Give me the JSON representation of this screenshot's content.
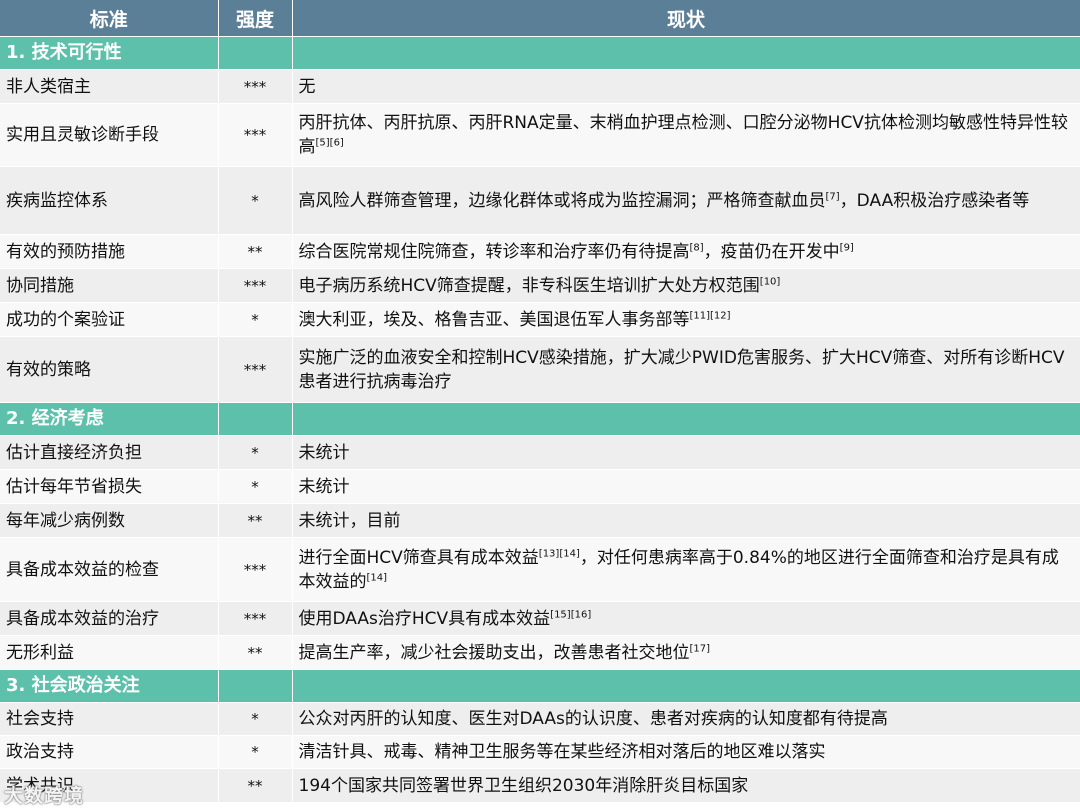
{
  "header": {
    "col1": "标准",
    "col2": "强度",
    "col3": "现状"
  },
  "sections": {
    "s1": "1. 技术可行性",
    "s2": "2. 经济考虑",
    "s3": "3. 社会政治关注"
  },
  "rows": {
    "r1": {
      "criterion": "非人类宿主",
      "strength": "***",
      "status": "无"
    },
    "r2": {
      "criterion": "实用且灵敏诊断手段",
      "strength": "***",
      "status": "丙肝抗体、丙肝抗原、丙肝RNA定量、末梢血护理点检测、口腔分泌物HCV抗体检测均敏感性特异性较高",
      "refs": "[5][6]"
    },
    "r3": {
      "criterion": "疾病监控体系",
      "strength": "*",
      "status_a": "高风险人群筛查管理，边缘化群体或将成为监控漏洞；严格筛查献血员",
      "refs": "[7]",
      "status_b": "，DAA积极治疗感染者等"
    },
    "r4": {
      "criterion": "有效的预防措施",
      "strength": "**",
      "status_a": "综合医院常规住院筛查，转诊率和治疗率仍有待提高",
      "refs_a": "[8]",
      "status_b": "，疫苗仍在开发中",
      "refs_b": "[9]"
    },
    "r5": {
      "criterion": "协同措施",
      "strength": "***",
      "status": "电子病历系统HCV筛查提醒，非专科医生培训扩大处方权范围",
      "refs": "[10]"
    },
    "r6": {
      "criterion": "成功的个案验证",
      "strength": "*",
      "status": "澳大利亚，埃及、格鲁吉亚、美国退伍军人事务部等",
      "refs": "[11][12]"
    },
    "r7": {
      "criterion": "有效的策略",
      "strength": "***",
      "status": "实施广泛的血液安全和控制HCV感染措施，扩大减少PWID危害服务、扩大HCV筛查、对所有诊断HCV患者进行抗病毒治疗"
    },
    "r8": {
      "criterion": "估计直接经济负担",
      "strength": "*",
      "status": "未统计"
    },
    "r9": {
      "criterion": "估计每年节省损失",
      "strength": "*",
      "status": "未统计"
    },
    "r10": {
      "criterion": "每年减少病例数",
      "strength": "**",
      "status": "未统计，目前"
    },
    "r11": {
      "criterion": "具备成本效益的检查",
      "strength": "***",
      "status_a": "进行全面HCV筛查具有成本效益",
      "refs_a": "[13][14]",
      "status_b": "，对任何患病率高于0.84%的地区进行全面筛查和治疗是具有成本效益的",
      "refs_b": "[14]"
    },
    "r12": {
      "criterion": "具备成本效益的治疗",
      "strength": "***",
      "status": "使用DAAs治疗HCV具有成本效益",
      "refs": "[15][16]"
    },
    "r13": {
      "criterion": "无形利益",
      "strength": "**",
      "status": "提高生产率，减少社会援助支出，改善患者社交地位",
      "refs": "[17]"
    },
    "r14": {
      "criterion": "社会支持",
      "strength": "*",
      "status": "公众对丙肝的认知度、医生对DAAs的认识度、患者对疾病的认知度都有待提高"
    },
    "r15": {
      "criterion": "政治支持",
      "strength": "*",
      "status": "清洁针具、戒毒、精神卫生服务等在某些经济相对落后的地区难以落实"
    },
    "r16": {
      "criterion": "学术共识",
      "strength": "**",
      "status": "194个国家共同签署世界卫生组织2030年消除肝炎目标国家"
    }
  },
  "watermark": "大数跨境"
}
